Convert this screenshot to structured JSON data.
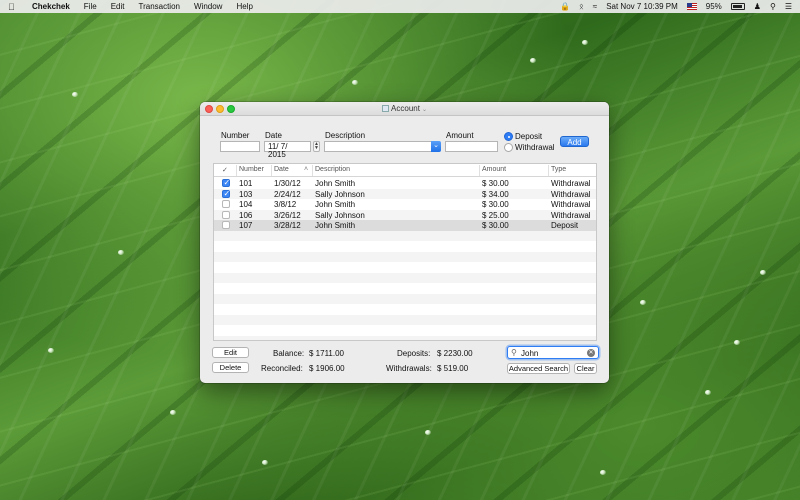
{
  "menubar": {
    "app_name": "Chekchek",
    "menus": [
      "File",
      "Edit",
      "Transaction",
      "Window",
      "Help"
    ],
    "clock": "Sat Nov 7  10:39 PM",
    "battery": "95%"
  },
  "window": {
    "title": "Account"
  },
  "form": {
    "number_label": "Number",
    "number_value": "",
    "date_label": "Date",
    "date_value": "11/  7/ 2015",
    "description_label": "Description",
    "description_value": "",
    "amount_label": "Amount",
    "amount_value": "",
    "deposit_label": "Deposit",
    "withdrawal_label": "Withdrawal",
    "selected_type": "Deposit",
    "add_label": "Add"
  },
  "table": {
    "columns": {
      "check": "✓",
      "number": "Number",
      "date": "Date",
      "description": "Description",
      "amount": "Amount",
      "type": "Type"
    },
    "rows": [
      {
        "checked": true,
        "number": "101",
        "date": "1/30/12",
        "description": "John Smith",
        "amount": "$ 30.00",
        "type": "Withdrawal"
      },
      {
        "checked": true,
        "number": "103",
        "date": "2/24/12",
        "description": "Sally Johnson",
        "amount": "$ 34.00",
        "type": "Withdrawal"
      },
      {
        "checked": false,
        "number": "104",
        "date": "3/8/12",
        "description": "John Smith",
        "amount": "$ 30.00",
        "type": "Withdrawal"
      },
      {
        "checked": false,
        "number": "106",
        "date": "3/26/12",
        "description": "Sally Johnson",
        "amount": "$ 25.00",
        "type": "Withdrawal"
      },
      {
        "checked": false,
        "number": "107",
        "date": "3/28/12",
        "description": "John Smith",
        "amount": "$ 30.00",
        "type": "Deposit"
      }
    ],
    "selected_row": 4
  },
  "footer": {
    "edit_label": "Edit",
    "delete_label": "Delete",
    "balance_label": "Balance:",
    "balance_value": "$ 1711.00",
    "reconciled_label": "Reconciled:",
    "reconciled_value": "$ 1906.00",
    "deposits_label": "Deposits:",
    "deposits_value": "$ 2230.00",
    "withdrawals_label": "Withdrawals:",
    "withdrawals_value": "$ 519.00",
    "search_value": "John",
    "advanced_search_label": "Advanced Search",
    "clear_label": "Clear"
  }
}
